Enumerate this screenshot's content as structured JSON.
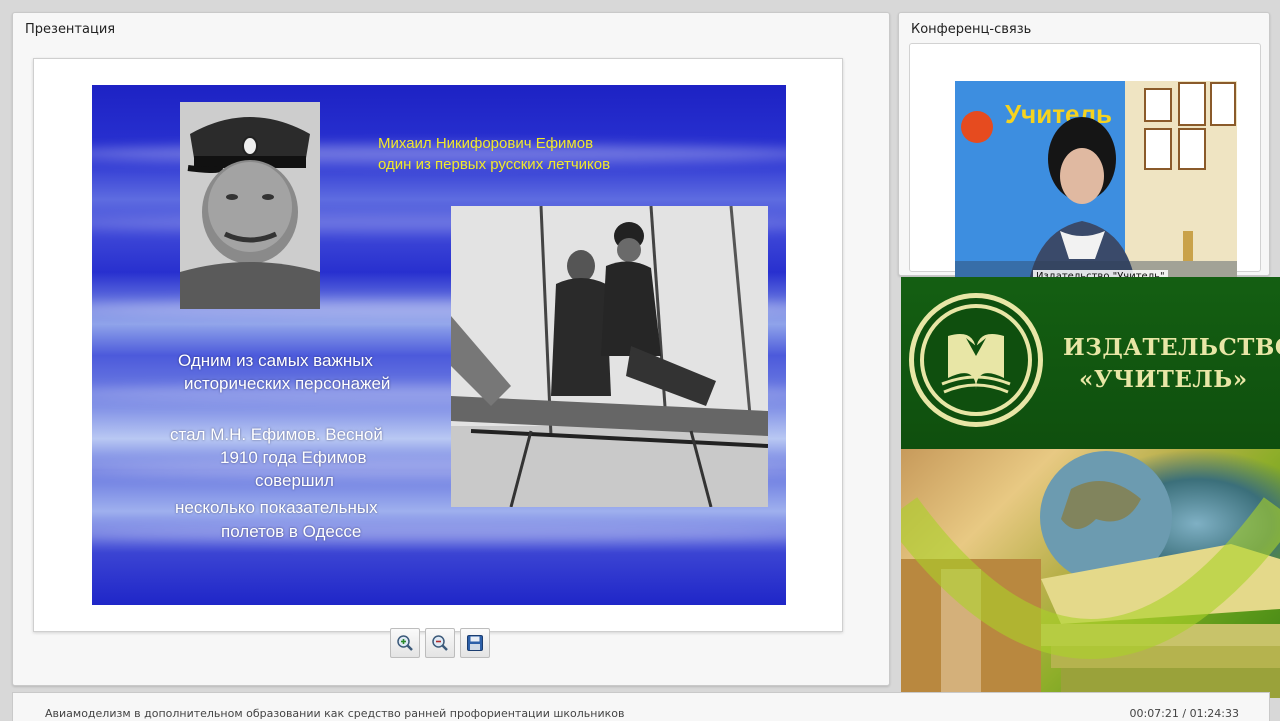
{
  "presentation": {
    "title": "Презентация",
    "slide": {
      "caption_line1": "Михаил Никифорович Ефимов",
      "caption_line2": "один из первых русских летчиков",
      "body": [
        "Одним из самых важных",
        "исторических персонажей",
        "стал М.Н. Ефимов. Весной",
        "1910 года Ефимов",
        "совершил",
        "несколько показательных",
        "полетов в Одессе"
      ]
    },
    "toolbar": {
      "zoom_in_icon": "zoom-in-icon",
      "zoom_out_icon": "zoom-out-icon",
      "save_icon": "save-icon"
    }
  },
  "conference": {
    "title": "Конференц-связь",
    "video_label": "Издательство \"Учитель\""
  },
  "banner": {
    "line1": "ИЗДАТЕЛЬСТВО",
    "line2": "«УЧИТЕЛЬ»",
    "colors": {
      "green": "#145f12",
      "cream": "#e8e6a6"
    }
  },
  "footer": {
    "title": "Авиамоделизм в дополнительном образовании как средство ранней профориентации школьников",
    "time": "00:07:21 / 01:24:33"
  }
}
